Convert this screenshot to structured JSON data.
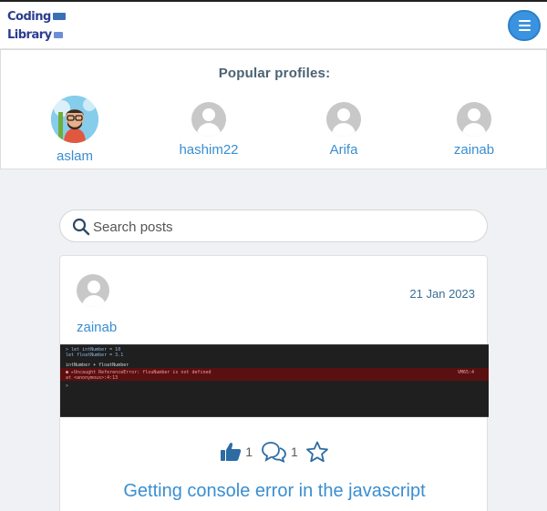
{
  "navbar": {
    "logo_line1": "Coding",
    "logo_line2": "Library",
    "menu_icon": "hamburger-icon"
  },
  "popular": {
    "title": "Popular profiles:",
    "profiles": [
      {
        "name": "aslam",
        "avatar": "photo"
      },
      {
        "name": "hashim22",
        "avatar": "default"
      },
      {
        "name": "Arifa",
        "avatar": "default"
      },
      {
        "name": "zainab",
        "avatar": "default"
      }
    ]
  },
  "search": {
    "placeholder": "Search posts",
    "icon": "search-icon"
  },
  "post": {
    "author": "zainab",
    "date": "21 Jan 2023",
    "likes": "1",
    "comments": "1",
    "title": "Getting console error in the javascript",
    "console_lines": [
      "> let intNumber = 10",
      "  let floatNumber = 3.1",
      "  intNumber + floatNumber",
      "● ▸Uncaught ReferenceError: flouNumber is not defined",
      "     at <anonymous>:4:13",
      ">"
    ],
    "console_ref": "VM65:4"
  },
  "colors": {
    "accent": "#3a8ed0",
    "menu_button": "#3a93e0",
    "logo": "#2a3d8f"
  }
}
